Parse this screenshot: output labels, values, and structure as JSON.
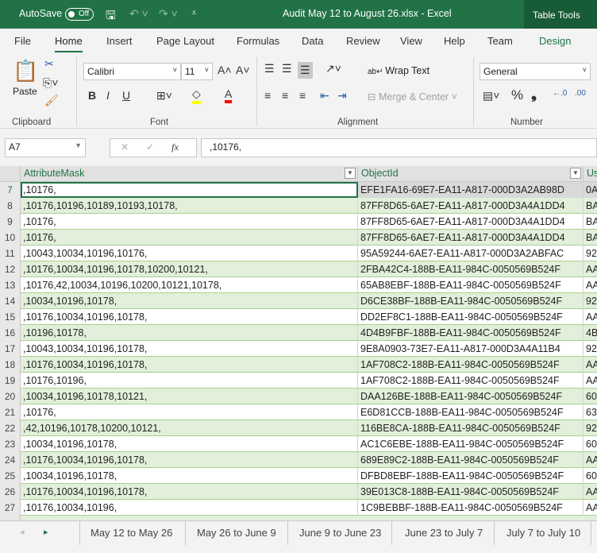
{
  "titlebar": {
    "autosave": "AutoSave",
    "autosave_state": "Off",
    "title": "Audit May 12 to August 26.xlsx  -  Excel",
    "table_tools": "Table Tools"
  },
  "menu": [
    "File",
    "Home",
    "Insert",
    "Page Layout",
    "Formulas",
    "Data",
    "Review",
    "View",
    "Help",
    "Team",
    "Design"
  ],
  "ribbon": {
    "paste": "Paste",
    "font_name": "Calibri",
    "font_size": "11",
    "wrap_text": "Wrap Text",
    "merge_center": "Merge & Center",
    "number_format": "General",
    "groups": [
      "Clipboard",
      "Font",
      "Alignment",
      "Number"
    ],
    "bold": "B",
    "italic": "I",
    "underline": "U",
    "highlight_color": "#ffff00",
    "font_color": "#ff0000"
  },
  "formula_bar": {
    "name_box": "A7",
    "fx": "fx",
    "value": ",10176,"
  },
  "table": {
    "headers": [
      "AttributeMask",
      "ObjectId",
      "Us"
    ],
    "rows": [
      {
        "n": "7",
        "a": ",10176,",
        "b": "EFE1FA16-69E7-EA11-A817-000D3A2AB98D",
        "c": "0A"
      },
      {
        "n": "8",
        "a": ",10176,10196,10189,10193,10178,",
        "b": "87FF8D65-6AE7-EA11-A817-000D3A4A1DD4",
        "c": "BA"
      },
      {
        "n": "9",
        "a": ",10176,",
        "b": "87FF8D65-6AE7-EA11-A817-000D3A4A1DD4",
        "c": "BA"
      },
      {
        "n": "10",
        "a": ",10176,",
        "b": "87FF8D65-6AE7-EA11-A817-000D3A4A1DD4",
        "c": "BA"
      },
      {
        "n": "11",
        "a": ",10043,10034,10196,10176,",
        "b": "95A59244-6AE7-EA11-A817-000D3A2ABFAC",
        "c": "92"
      },
      {
        "n": "12",
        "a": ",10176,10034,10196,10178,10200,10121,",
        "b": "2FBA42C4-188B-EA11-984C-0050569B524F",
        "c": "AA"
      },
      {
        "n": "13",
        "a": ",10176,42,10034,10196,10200,10121,10178,",
        "b": "65AB8EBF-188B-EA11-984C-0050569B524F",
        "c": "AA"
      },
      {
        "n": "14",
        "a": ",10034,10196,10178,",
        "b": "D6CE38BF-188B-EA11-984C-0050569B524F",
        "c": "92"
      },
      {
        "n": "15",
        "a": ",10176,10034,10196,10178,",
        "b": "DD2EF8C1-188B-EA11-984C-0050569B524F",
        "c": "AA"
      },
      {
        "n": "16",
        "a": ",10196,10178,",
        "b": "4D4B9FBF-188B-EA11-984C-0050569B524F",
        "c": "4B"
      },
      {
        "n": "17",
        "a": ",10043,10034,10196,10178,",
        "b": "9E8A0903-73E7-EA11-A817-000D3A4A11B4",
        "c": "92"
      },
      {
        "n": "18",
        "a": ",10176,10034,10196,10178,",
        "b": "1AF708C2-188B-EA11-984C-0050569B524F",
        "c": "AA"
      },
      {
        "n": "19",
        "a": ",10176,10196,",
        "b": "1AF708C2-188B-EA11-984C-0050569B524F",
        "c": "AA"
      },
      {
        "n": "20",
        "a": ",10034,10196,10178,10121,",
        "b": "DAA126BE-188B-EA11-984C-0050569B524F",
        "c": "60"
      },
      {
        "n": "21",
        "a": ",10176,",
        "b": "E6D81CCB-188B-EA11-984C-0050569B524F",
        "c": "63"
      },
      {
        "n": "22",
        "a": ",42,10196,10178,10200,10121,",
        "b": "116BE8CA-188B-EA11-984C-0050569B524F",
        "c": "92"
      },
      {
        "n": "23",
        "a": ",10034,10196,10178,",
        "b": "AC1C6EBE-188B-EA11-984C-0050569B524F",
        "c": "60"
      },
      {
        "n": "24",
        "a": ",10176,10034,10196,10178,",
        "b": "689E89C2-188B-EA11-984C-0050569B524F",
        "c": "AA"
      },
      {
        "n": "25",
        "a": ",10034,10196,10178,",
        "b": "DFBD8EBF-188B-EA11-984C-0050569B524F",
        "c": "60"
      },
      {
        "n": "26",
        "a": ",10176,10034,10196,10178,",
        "b": "39E013C8-188B-EA11-984C-0050569B524F",
        "c": "AA"
      },
      {
        "n": "27",
        "a": ",10176,10034,10196,",
        "b": "1C9BEBBF-188B-EA11-984C-0050569B524F",
        "c": "AA"
      }
    ]
  },
  "sheet_tabs": [
    "May 12 to May 26",
    "May 26 to June 9",
    "June 9 to June 23",
    "June 23 to July 7",
    "July 7 to July 10"
  ],
  "colors": {
    "excel_green": "#217346",
    "band": "#e2efda",
    "band_border": "#a9d08e"
  }
}
